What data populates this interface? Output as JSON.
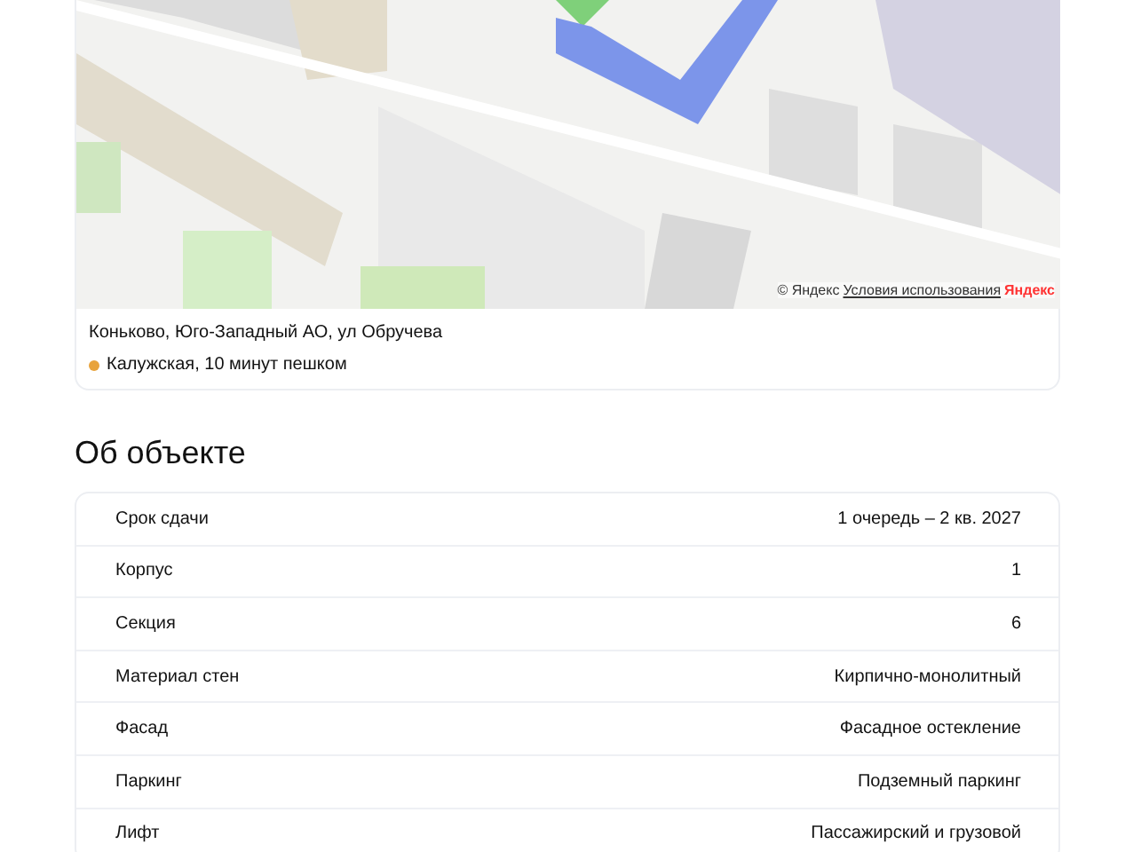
{
  "map": {
    "kind": "picture",
    "attribution": "© Яндекс",
    "terms_link": "Условия использования",
    "logo": "Яндекс"
  },
  "location": {
    "address": "Коньково, Юго-Западный АО, ул Обручева",
    "metro": [
      {
        "text": "Калужская, 10 минут пешком",
        "color": "#e8a33b"
      }
    ]
  },
  "about": {
    "title": "Об объекте",
    "rows": [
      {
        "label": "Срок сдачи",
        "value": "1 очередь – 2 кв. 2027"
      },
      {
        "label": "Корпус",
        "value": "1"
      },
      {
        "label": "Секция",
        "value": "6"
      },
      {
        "label": "Материал стен",
        "value": "Кирпично-монолитный"
      },
      {
        "label": "Фасад",
        "value": "Фасадное остекление"
      },
      {
        "label": "Паркинг",
        "value": "Подземный паркинг"
      },
      {
        "label": "Лифт",
        "value": "Пассажирский и грузовой"
      }
    ]
  }
}
